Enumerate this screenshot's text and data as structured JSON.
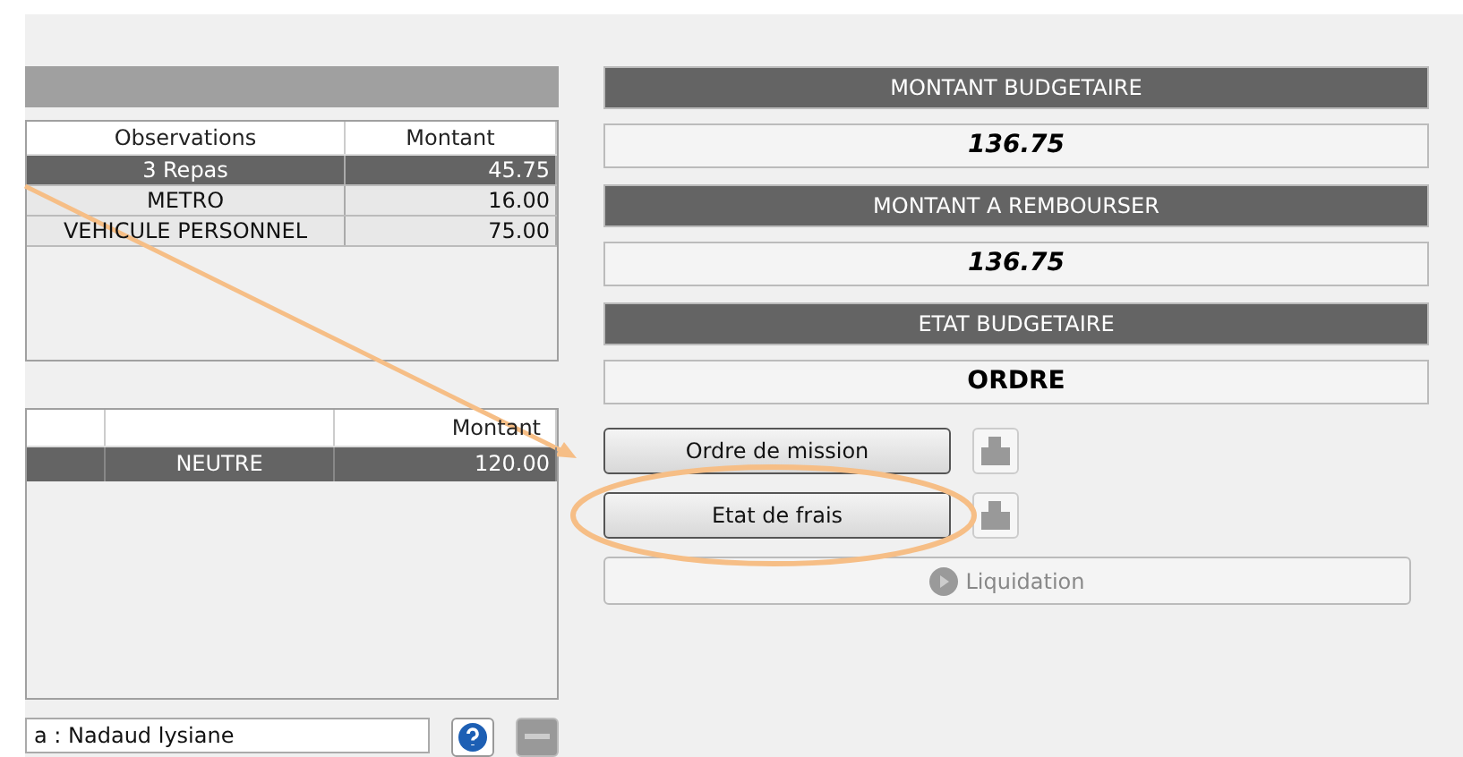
{
  "expenses_table": {
    "columns": [
      "Observations",
      "Montant"
    ],
    "rows": [
      {
        "cells": [
          "3 Repas",
          "45.75"
        ],
        "selected": true
      },
      {
        "cells": [
          "METRO",
          "16.00"
        ],
        "selected": false
      },
      {
        "cells": [
          "VEHICULE PERSONNEL",
          "75.00"
        ],
        "selected": false
      }
    ]
  },
  "budget_table": {
    "columns": [
      "",
      "",
      "Montant"
    ],
    "rows": [
      {
        "cells": [
          "",
          "NEUTRE",
          "120.00"
        ],
        "selected": true
      }
    ]
  },
  "agent_field": {
    "value": "a : Nadaud lysiane"
  },
  "summary": [
    {
      "label": "MONTANT BUDGETAIRE",
      "value": "136.75",
      "italic": true
    },
    {
      "label": "MONTANT A REMBOURSER",
      "value": "136.75",
      "italic": true
    },
    {
      "label": "ETAT BUDGETAIRE",
      "value": "ORDRE",
      "italic": false
    }
  ],
  "document_buttons": [
    {
      "label": "Ordre de mission",
      "highlighted": false
    },
    {
      "label": "Etat de frais",
      "highlighted": true
    }
  ],
  "liquidation_button": {
    "label": "Liquidation",
    "disabled": true
  }
}
